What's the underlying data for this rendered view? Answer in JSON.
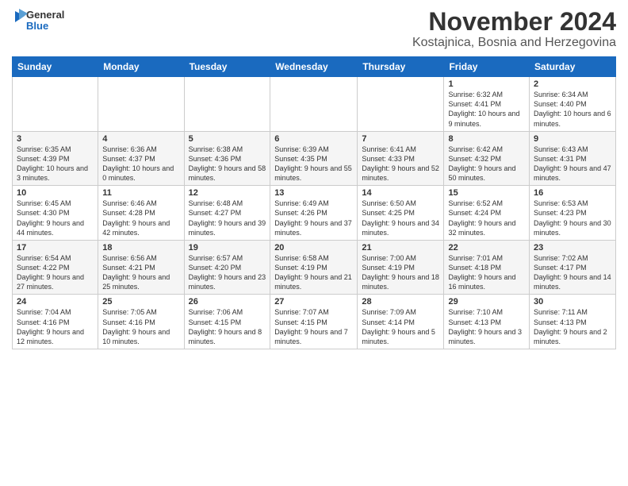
{
  "header": {
    "logo": {
      "general": "General",
      "blue": "Blue"
    },
    "month": "November 2024",
    "location": "Kostajnica, Bosnia and Herzegovina"
  },
  "days_of_week": [
    "Sunday",
    "Monday",
    "Tuesday",
    "Wednesday",
    "Thursday",
    "Friday",
    "Saturday"
  ],
  "weeks": [
    [
      {
        "day": "",
        "info": ""
      },
      {
        "day": "",
        "info": ""
      },
      {
        "day": "",
        "info": ""
      },
      {
        "day": "",
        "info": ""
      },
      {
        "day": "",
        "info": ""
      },
      {
        "day": "1",
        "info": "Sunrise: 6:32 AM\nSunset: 4:41 PM\nDaylight: 10 hours and 9 minutes."
      },
      {
        "day": "2",
        "info": "Sunrise: 6:34 AM\nSunset: 4:40 PM\nDaylight: 10 hours and 6 minutes."
      }
    ],
    [
      {
        "day": "3",
        "info": "Sunrise: 6:35 AM\nSunset: 4:39 PM\nDaylight: 10 hours and 3 minutes."
      },
      {
        "day": "4",
        "info": "Sunrise: 6:36 AM\nSunset: 4:37 PM\nDaylight: 10 hours and 0 minutes."
      },
      {
        "day": "5",
        "info": "Sunrise: 6:38 AM\nSunset: 4:36 PM\nDaylight: 9 hours and 58 minutes."
      },
      {
        "day": "6",
        "info": "Sunrise: 6:39 AM\nSunset: 4:35 PM\nDaylight: 9 hours and 55 minutes."
      },
      {
        "day": "7",
        "info": "Sunrise: 6:41 AM\nSunset: 4:33 PM\nDaylight: 9 hours and 52 minutes."
      },
      {
        "day": "8",
        "info": "Sunrise: 6:42 AM\nSunset: 4:32 PM\nDaylight: 9 hours and 50 minutes."
      },
      {
        "day": "9",
        "info": "Sunrise: 6:43 AM\nSunset: 4:31 PM\nDaylight: 9 hours and 47 minutes."
      }
    ],
    [
      {
        "day": "10",
        "info": "Sunrise: 6:45 AM\nSunset: 4:30 PM\nDaylight: 9 hours and 44 minutes."
      },
      {
        "day": "11",
        "info": "Sunrise: 6:46 AM\nSunset: 4:28 PM\nDaylight: 9 hours and 42 minutes."
      },
      {
        "day": "12",
        "info": "Sunrise: 6:48 AM\nSunset: 4:27 PM\nDaylight: 9 hours and 39 minutes."
      },
      {
        "day": "13",
        "info": "Sunrise: 6:49 AM\nSunset: 4:26 PM\nDaylight: 9 hours and 37 minutes."
      },
      {
        "day": "14",
        "info": "Sunrise: 6:50 AM\nSunset: 4:25 PM\nDaylight: 9 hours and 34 minutes."
      },
      {
        "day": "15",
        "info": "Sunrise: 6:52 AM\nSunset: 4:24 PM\nDaylight: 9 hours and 32 minutes."
      },
      {
        "day": "16",
        "info": "Sunrise: 6:53 AM\nSunset: 4:23 PM\nDaylight: 9 hours and 30 minutes."
      }
    ],
    [
      {
        "day": "17",
        "info": "Sunrise: 6:54 AM\nSunset: 4:22 PM\nDaylight: 9 hours and 27 minutes."
      },
      {
        "day": "18",
        "info": "Sunrise: 6:56 AM\nSunset: 4:21 PM\nDaylight: 9 hours and 25 minutes."
      },
      {
        "day": "19",
        "info": "Sunrise: 6:57 AM\nSunset: 4:20 PM\nDaylight: 9 hours and 23 minutes."
      },
      {
        "day": "20",
        "info": "Sunrise: 6:58 AM\nSunset: 4:19 PM\nDaylight: 9 hours and 21 minutes."
      },
      {
        "day": "21",
        "info": "Sunrise: 7:00 AM\nSunset: 4:19 PM\nDaylight: 9 hours and 18 minutes."
      },
      {
        "day": "22",
        "info": "Sunrise: 7:01 AM\nSunset: 4:18 PM\nDaylight: 9 hours and 16 minutes."
      },
      {
        "day": "23",
        "info": "Sunrise: 7:02 AM\nSunset: 4:17 PM\nDaylight: 9 hours and 14 minutes."
      }
    ],
    [
      {
        "day": "24",
        "info": "Sunrise: 7:04 AM\nSunset: 4:16 PM\nDaylight: 9 hours and 12 minutes."
      },
      {
        "day": "25",
        "info": "Sunrise: 7:05 AM\nSunset: 4:16 PM\nDaylight: 9 hours and 10 minutes."
      },
      {
        "day": "26",
        "info": "Sunrise: 7:06 AM\nSunset: 4:15 PM\nDaylight: 9 hours and 8 minutes."
      },
      {
        "day": "27",
        "info": "Sunrise: 7:07 AM\nSunset: 4:15 PM\nDaylight: 9 hours and 7 minutes."
      },
      {
        "day": "28",
        "info": "Sunrise: 7:09 AM\nSunset: 4:14 PM\nDaylight: 9 hours and 5 minutes."
      },
      {
        "day": "29",
        "info": "Sunrise: 7:10 AM\nSunset: 4:13 PM\nDaylight: 9 hours and 3 minutes."
      },
      {
        "day": "30",
        "info": "Sunrise: 7:11 AM\nSunset: 4:13 PM\nDaylight: 9 hours and 2 minutes."
      }
    ]
  ]
}
